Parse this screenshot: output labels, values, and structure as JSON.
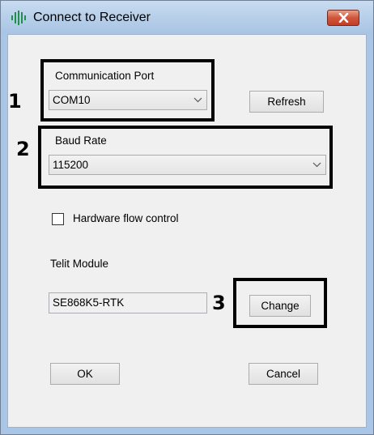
{
  "window": {
    "title": "Connect to Receiver",
    "close_icon": "close-x-icon",
    "app_icon": "signal-bars-icon"
  },
  "communication_port": {
    "label": "Communication Port",
    "selected": "COM10",
    "refresh_label": "Refresh"
  },
  "baud_rate": {
    "label": "Baud Rate",
    "selected": "115200"
  },
  "hardware_flow_control": {
    "label": "Hardware flow control",
    "checked": false
  },
  "telit_module": {
    "label": "Telit Module",
    "value": "SE868K5-RTK",
    "change_label": "Change"
  },
  "footer": {
    "ok_label": "OK",
    "cancel_label": "Cancel"
  },
  "callouts": [
    "1",
    "2",
    "3"
  ],
  "colors": {
    "title_bar": "#b7cfe9",
    "close_button": "#c23e27",
    "dialog_background": "#f0f0f0",
    "highlight_border": "#000000"
  }
}
